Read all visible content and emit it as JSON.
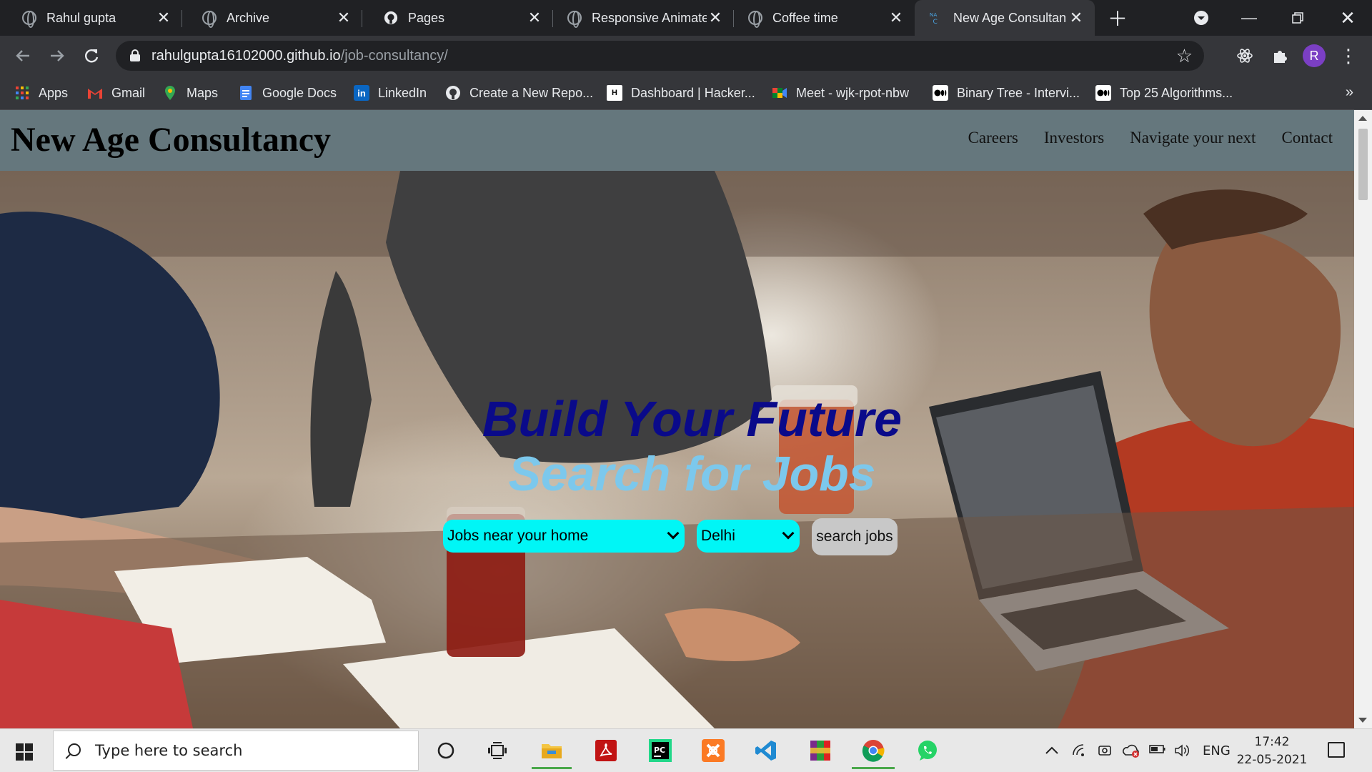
{
  "browser": {
    "tabs": [
      {
        "title": "Rahul gupta",
        "icon": "globe-icon"
      },
      {
        "title": "Archive",
        "icon": "globe-icon"
      },
      {
        "title": "Pages",
        "icon": "github-icon"
      },
      {
        "title": "Responsive Animate",
        "icon": "globe-icon"
      },
      {
        "title": "Coffee time",
        "icon": "globe-icon"
      },
      {
        "title": "New Age Consultan",
        "icon": "nac-icon",
        "active": true
      }
    ],
    "url_host": "rahulgupta16102000.github.io",
    "url_path": "/job-consultancy/",
    "profile_initial": "R",
    "bookmarks": [
      {
        "label": "Apps",
        "icon": "apps-grid-icon"
      },
      {
        "label": "Gmail",
        "icon": "gmail-icon"
      },
      {
        "label": "Maps",
        "icon": "maps-icon"
      },
      {
        "label": "Google Docs",
        "icon": "docs-icon"
      },
      {
        "label": "LinkedIn",
        "icon": "linkedin-icon"
      },
      {
        "label": "Create a New Repo...",
        "icon": "github-icon"
      },
      {
        "label": "Dashboard | Hacker...",
        "icon": "hackerrank-icon"
      },
      {
        "label": "Meet - wjk-rpot-nbw",
        "icon": "meet-icon"
      },
      {
        "label": "Binary Tree - Intervi...",
        "icon": "medium-icon"
      },
      {
        "label": "Top 25 Algorithms...",
        "icon": "medium-icon"
      }
    ],
    "bookmarks_more": "»"
  },
  "site": {
    "brand": "New Age Consultancy",
    "nav": [
      "Careers",
      "Investors",
      "Navigate your next",
      "Contact"
    ],
    "hero_title": "Build Your Future",
    "hero_subtitle": "Search for Jobs",
    "job_type_selected": "Jobs near your home",
    "city_selected": "Delhi",
    "search_button": "search jobs"
  },
  "taskbar": {
    "search_placeholder": "Type here to search",
    "language": "ENG",
    "time": "17:42",
    "date": "22-05-2021"
  },
  "colors": {
    "nav_bg": "#65777d",
    "hero_title": "#0a0a8a",
    "hero_subtitle": "#7cc8ec",
    "select_bg": "#00f6f6"
  }
}
